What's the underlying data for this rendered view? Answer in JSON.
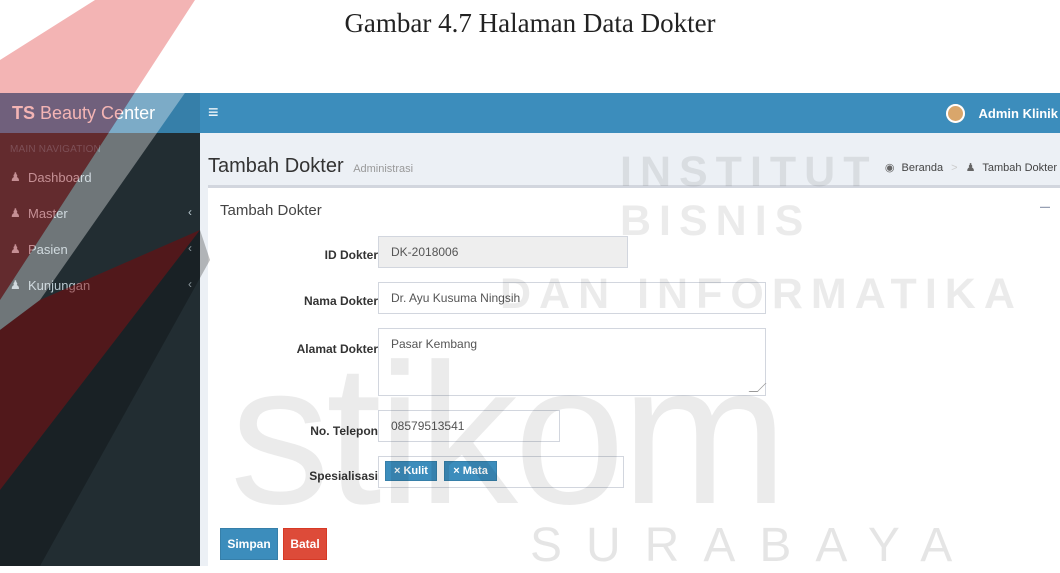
{
  "caption": "Gambar 4.7 Halaman Data Dokter",
  "brand": {
    "bold": "TS",
    "rest": "Beauty Center"
  },
  "topbar": {
    "menu_icon": "hamburger-icon",
    "user_name": "Admin Klinik"
  },
  "sidebar": {
    "header": "MAIN NAVIGATION",
    "items": [
      {
        "label": "Dashboard",
        "icon": "users-icon",
        "has_chevron": false
      },
      {
        "label": "Master",
        "icon": "users-icon",
        "has_chevron": true
      },
      {
        "label": "Pasien",
        "icon": "users-icon",
        "has_chevron": true
      },
      {
        "label": "Kunjungan",
        "icon": "users-icon",
        "has_chevron": true
      }
    ]
  },
  "page": {
    "title": "Tambah Dokter",
    "subtitle": "Administrasi",
    "breadcrumb": [
      {
        "label": "Beranda",
        "icon": "dashboard-icon"
      },
      {
        "label": "Tambah Dokter",
        "icon": "users-icon"
      }
    ]
  },
  "form": {
    "box_title": "Tambah Dokter",
    "fields": {
      "id": {
        "label": "ID Dokter",
        "value": "DK-2018006"
      },
      "nama": {
        "label": "Nama Dokter",
        "value": "Dr. Ayu Kusuma Ningsih"
      },
      "alamat": {
        "label": "Alamat Dokter",
        "value": "Pasar Kembang"
      },
      "telepon": {
        "label": "No. Telepon",
        "value": "08579513541"
      },
      "spesialisasi": {
        "label": "Spesialisasi",
        "tags": [
          "Kulit",
          "Mata"
        ]
      }
    },
    "buttons": {
      "save": "Simpan",
      "cancel": "Batal"
    }
  },
  "watermark": {
    "line1": "INSTITUT BISNIS",
    "line2": "DAN INFORMATIKA",
    "logo_text": "stikom",
    "city": "SURABAYA"
  },
  "colors": {
    "primary": "#3c8dbc",
    "danger": "#dd4b39",
    "sidebar": "#222d32"
  }
}
